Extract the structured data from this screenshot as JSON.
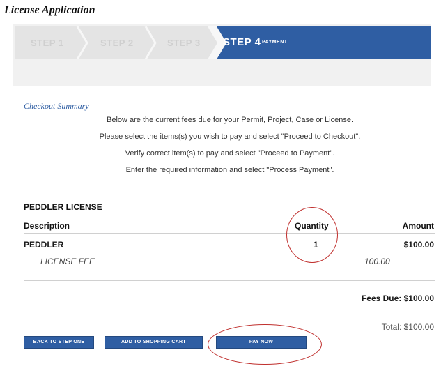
{
  "page": {
    "title": "License Application"
  },
  "steps": [
    {
      "label": "STEP 1"
    },
    {
      "label": "STEP 2"
    },
    {
      "label": "STEP 3"
    },
    {
      "label": "STEP 4",
      "sublabel": "PAYMENT",
      "active": true
    }
  ],
  "summary": {
    "title": "Checkout Summary",
    "instructions": [
      "Below are the current fees due for your Permit, Project, Case or License.",
      "Please select the items(s) you wish to pay and select \"Proceed to Checkout\".",
      "Verify correct item(s) to pay and select \"Proceed to Payment\".",
      "Enter the required information and select \"Process Payment\"."
    ]
  },
  "fees_table": {
    "section_title": "PEDDLER LICENSE",
    "columns": {
      "description": "Description",
      "quantity": "Quantity",
      "amount": "Amount"
    },
    "rows": [
      {
        "description": "PEDDLER",
        "quantity": "1",
        "amount": "$100.00"
      },
      {
        "description": "LICENSE FEE",
        "amount": "100.00"
      }
    ]
  },
  "totals": {
    "fees_due": "Fees Due: $100.00",
    "total": "Total: $100.00"
  },
  "buttons": {
    "back": "BACK TO STEP ONE",
    "cart": "ADD TO SHOPPING CART",
    "pay": "PAY NOW"
  },
  "colors": {
    "accent": "#2f5ea3",
    "annotation": "#c0302e"
  }
}
